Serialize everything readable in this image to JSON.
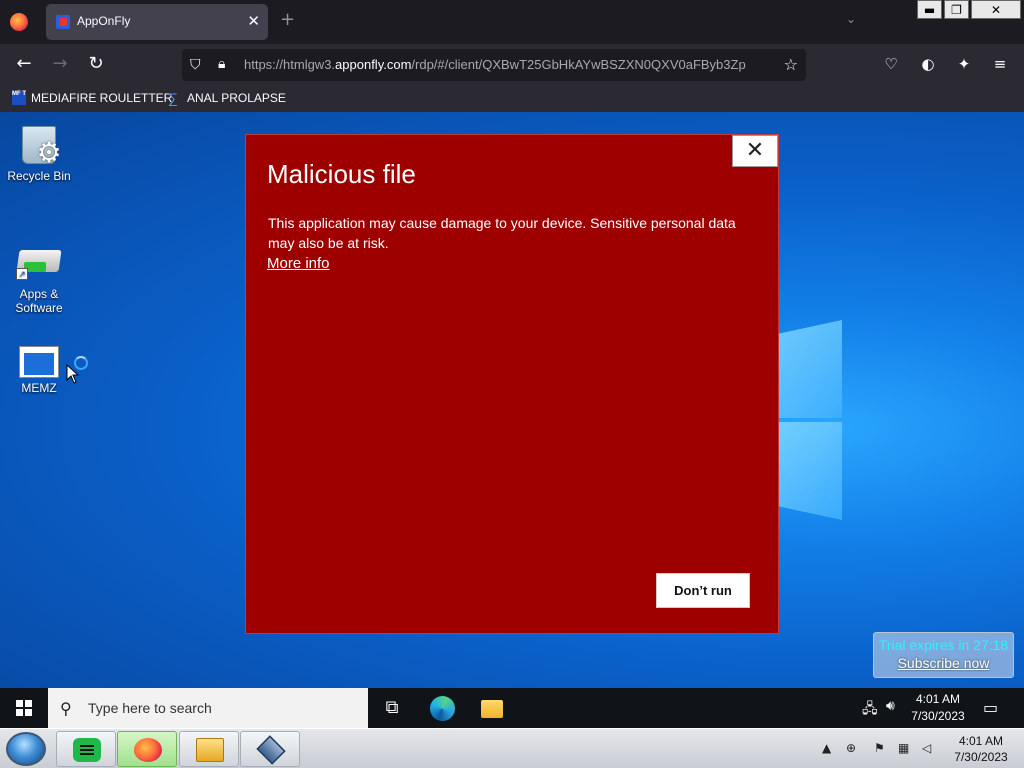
{
  "browser": {
    "tab_title": "AppOnFly",
    "tab_close": "✕",
    "new_tab": "+",
    "tab_list": "⌄",
    "url_prefix": "https://htmlgw3.",
    "url_domain": "apponfly.com",
    "url_suffix": "/rdp/#/client/QXBwT25GbHkAYwBSZXN0QXV0aFByb3Zp",
    "window_controls": {
      "minimize": "▬",
      "restore": "❐",
      "close": "✕"
    },
    "bookmarks": [
      {
        "label": "MEDIAFIRE ROULETTER",
        "icon": "mediafire-icon",
        "icon_text": "MF T"
      },
      {
        "label": "ANAL PROLAPSE",
        "icon": "sigma-icon",
        "icon_text": "∑"
      }
    ],
    "accent": "#1c1b22"
  },
  "desktop": {
    "icons": [
      {
        "label": "Recycle Bin",
        "icon": "recycle-bin-icon"
      },
      {
        "label": "Apps & Software",
        "icon": "apps-software-icon"
      },
      {
        "label": "MEMZ",
        "icon": "memz-icon"
      }
    ],
    "trial_text": "Trial expires in 27:18",
    "subscribe_text": "Subscribe now"
  },
  "dialog": {
    "title": "Malicious file",
    "body": "This application may cause damage to your device. Sensitive personal data may also be at risk.",
    "link": "More info",
    "button": "Don’t run",
    "close": "✕",
    "color": "#9e0000"
  },
  "remote_taskbar": {
    "search_placeholder": "Type here to search",
    "time": "4:01 AM",
    "date": "7/30/2023"
  },
  "host_taskbar": {
    "time": "4:01 AM",
    "date": "7/30/2023"
  }
}
